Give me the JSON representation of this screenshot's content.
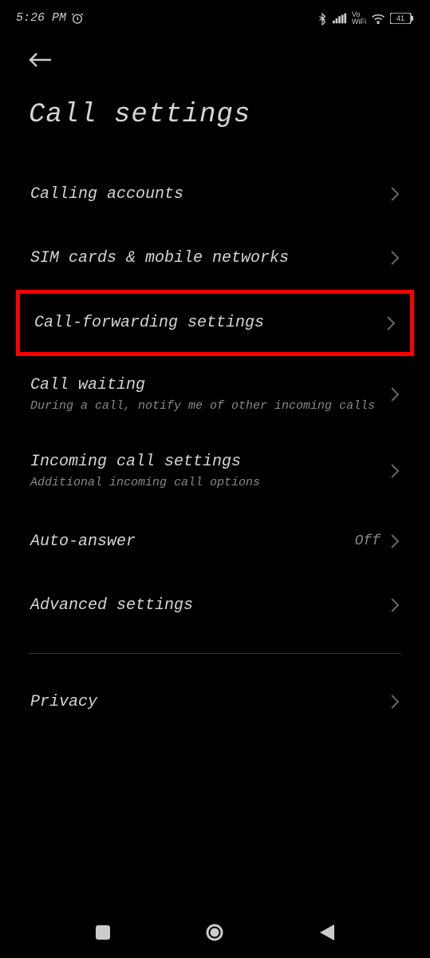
{
  "status_bar": {
    "time": "5:26 PM",
    "battery": "41"
  },
  "page_title": "Call settings",
  "items": [
    {
      "title": "Calling accounts",
      "subtitle": null,
      "value": null
    },
    {
      "title": "SIM cards & mobile networks",
      "subtitle": null,
      "value": null
    },
    {
      "title": "Call-forwarding settings",
      "subtitle": null,
      "value": null
    },
    {
      "title": "Call waiting",
      "subtitle": "During a call, notify me of other incoming calls",
      "value": null
    },
    {
      "title": "Incoming call settings",
      "subtitle": "Additional incoming call options",
      "value": null
    },
    {
      "title": "Auto-answer",
      "subtitle": null,
      "value": "Off"
    },
    {
      "title": "Advanced settings",
      "subtitle": null,
      "value": null
    },
    {
      "title": "Privacy",
      "subtitle": null,
      "value": null
    }
  ]
}
